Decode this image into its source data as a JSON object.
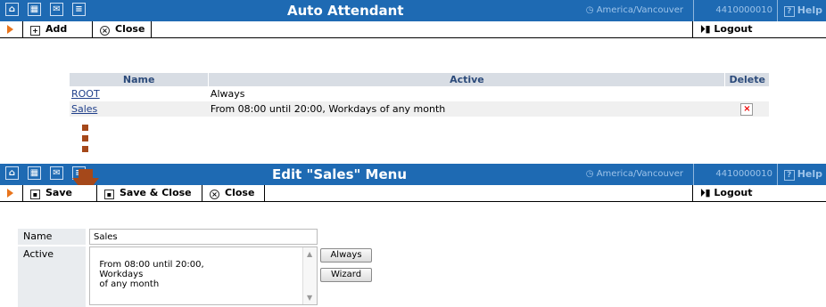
{
  "top_window": {
    "title": "Auto Attendant",
    "timezone": "America/Vancouver",
    "account": "4410000010",
    "help_label": "Help",
    "toolbar": {
      "add_label": "Add",
      "close_label": "Close",
      "logout_label": "Logout"
    },
    "table": {
      "headers": {
        "name": "Name",
        "active": "Active",
        "delete": "Delete"
      },
      "rows": [
        {
          "name": "ROOT",
          "active": "Always"
        },
        {
          "name": "Sales",
          "active": "From 08:00 until 20:00, Workdays of any month"
        }
      ]
    }
  },
  "bottom_window": {
    "title": "Edit \"Sales\" Menu",
    "timezone": "America/Vancouver",
    "account": "4410000010",
    "help_label": "Help",
    "toolbar": {
      "save_label": "Save",
      "save_close_label": "Save & Close",
      "close_label": "Close",
      "logout_label": "Logout"
    },
    "form": {
      "name_label": "Name",
      "name_value": "Sales",
      "active_label": "Active",
      "active_value": "From 08:00 until 20:00,\n  Workdays\n  of any month",
      "always_button": "Always",
      "wizard_button": "Wizard"
    }
  },
  "colors": {
    "titlebar": "#1e6ab3",
    "accent_arrow": "#e8741c",
    "connector": "#a5481a"
  }
}
